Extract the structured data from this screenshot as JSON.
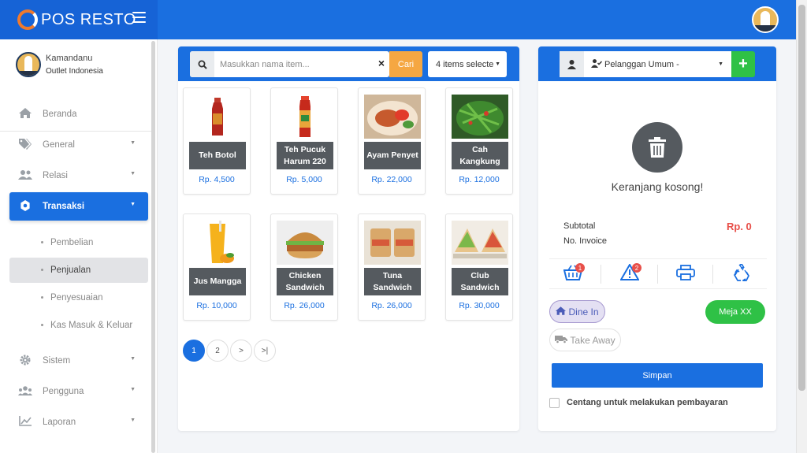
{
  "app": {
    "title": "POS RESTO",
    "accent": "#1a6fe0",
    "accent_dark": "#1663d6"
  },
  "header": {
    "menu_icon": "hamburger-icon",
    "avatar_icon": "avatar"
  },
  "user": {
    "name": "Kamandanu",
    "outlet": "Outlet Indonesia"
  },
  "sidebar": {
    "items": [
      {
        "label": "Beranda",
        "icon": "home-icon"
      },
      {
        "label": "General",
        "icon": "tag-icon",
        "has_children": true
      },
      {
        "label": "Relasi",
        "icon": "users-icon",
        "has_children": true
      },
      {
        "label": "Transaksi",
        "icon": "gear-icon",
        "has_children": true,
        "active": true
      }
    ],
    "transaksi_children": [
      {
        "label": "Pembelian"
      },
      {
        "label": "Penjualan",
        "current": true
      },
      {
        "label": "Penyesuaian"
      },
      {
        "label": "Kas Masuk & Keluar"
      }
    ],
    "bottom_items": [
      {
        "label": "Sistem",
        "icon": "cog-icon"
      },
      {
        "label": "Pengguna",
        "icon": "user-group-icon"
      },
      {
        "label": "Laporan",
        "icon": "chart-line-icon"
      }
    ]
  },
  "search": {
    "placeholder": "Masukkan nama item...",
    "value": "",
    "clear": "×",
    "button": "Cari"
  },
  "filter": {
    "label": "4 items selecte"
  },
  "products": [
    {
      "name": "Teh Botol",
      "price": "Rp. 4,500"
    },
    {
      "name": "Teh Pucuk Harum 220",
      "price": "Rp. 5,000"
    },
    {
      "name": "Ayam Penyet",
      "price": "Rp. 22,000"
    },
    {
      "name": "Cah Kangkung",
      "price": "Rp. 12,000"
    },
    {
      "name": "Jus Mangga",
      "price": "Rp. 10,000"
    },
    {
      "name": "Chicken Sandwich",
      "price": "Rp. 26,000"
    },
    {
      "name": "Tuna Sandwich",
      "price": "Rp. 26,000"
    },
    {
      "name": "Club Sandwich",
      "price": "Rp. 30,000"
    }
  ],
  "pagination": {
    "pages": [
      "1",
      "2",
      ">",
      ">|"
    ],
    "current": "1"
  },
  "cart": {
    "customer": "Pelanggan Umum -",
    "add_customer": "+",
    "empty_text": "Keranjang kosong!",
    "subtotal_label": "Subtotal",
    "subtotal_value": "Rp. 0",
    "invoice_label": "No. Invoice",
    "badges": {
      "basket": "1",
      "warning": "2"
    },
    "dine_in": "Dine In",
    "take_away": "Take Away",
    "table": "Meja XX",
    "save": "Simpan",
    "pay_checkbox": "Centang untuk melakukan pembayaran"
  }
}
